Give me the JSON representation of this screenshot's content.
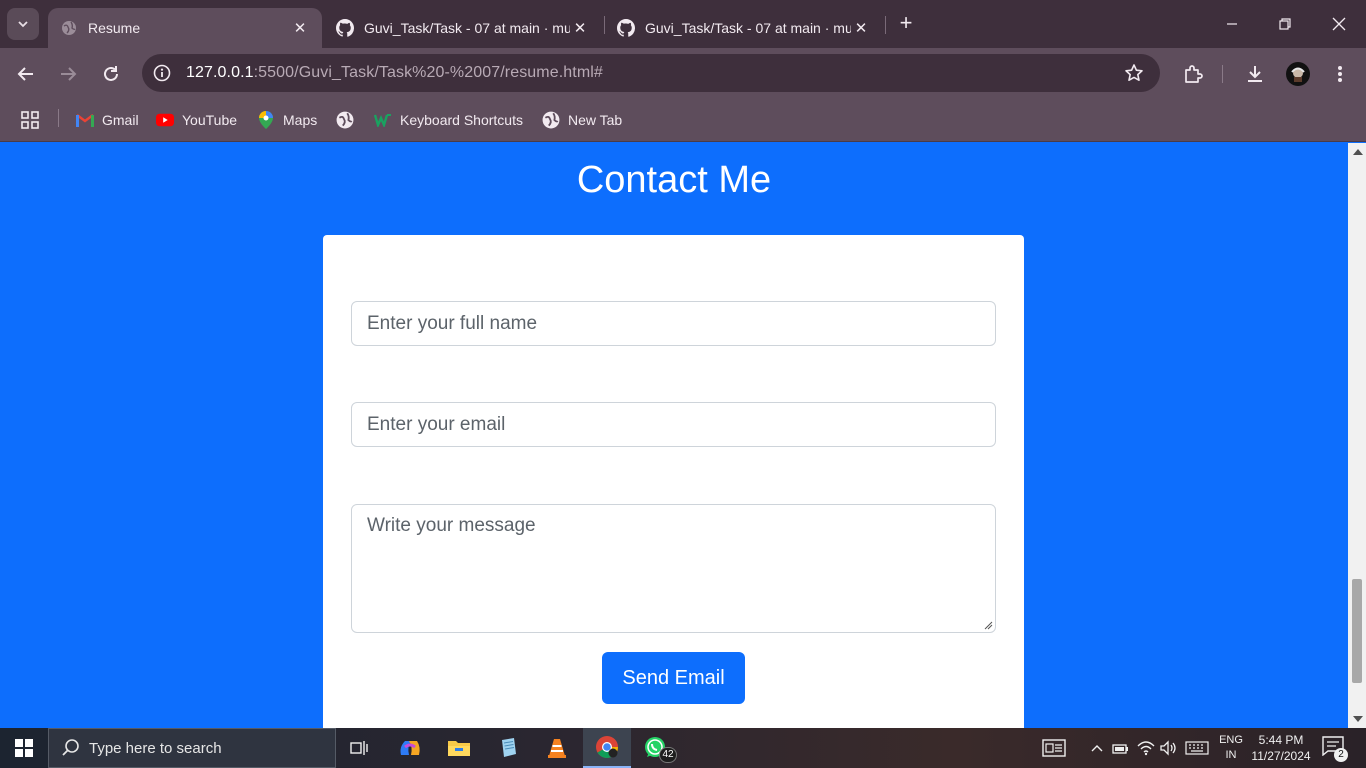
{
  "browser": {
    "tabs": [
      {
        "title": "Resume",
        "icon": "globe-icon",
        "active": true
      },
      {
        "title": "Guvi_Task/Task - 07 at main · mu",
        "icon": "github-icon",
        "active": false
      },
      {
        "title": "Guvi_Task/Task - 07 at main · mu",
        "icon": "github-icon",
        "active": false
      }
    ],
    "close_glyph": "✕",
    "new_tab_glyph": "+",
    "url_host": "127.0.0.1",
    "url_rest": ":5500/Guvi_Task/Task%20-%2007/resume.html#",
    "bookmarks": [
      {
        "label": "Gmail",
        "icon": "gmail-icon"
      },
      {
        "label": "YouTube",
        "icon": "youtube-icon"
      },
      {
        "label": "Maps",
        "icon": "maps-icon"
      },
      {
        "label": "",
        "icon": "globe-icon"
      },
      {
        "label": "Keyboard Shortcuts",
        "icon": "keyboard-shortcuts-icon"
      },
      {
        "label": "New Tab",
        "icon": "globe-icon"
      }
    ]
  },
  "page": {
    "title": "Contact Me",
    "form": {
      "name_placeholder": "Enter your full name",
      "email_placeholder": "Enter your email",
      "message_placeholder": "Write your message",
      "submit_label": "Send Email"
    }
  },
  "taskbar": {
    "search_placeholder": "Type here to search",
    "whatsapp_badge": "42",
    "lang_line1": "ENG",
    "lang_line2": "IN",
    "time": "5:44 PM",
    "date": "11/27/2024",
    "notification_count": "2"
  },
  "colors": {
    "page_bg": "#0d6efd",
    "button_bg": "#0d6efd",
    "chrome_dark": "#3e2f3c",
    "chrome_light": "#5e4d5c"
  }
}
